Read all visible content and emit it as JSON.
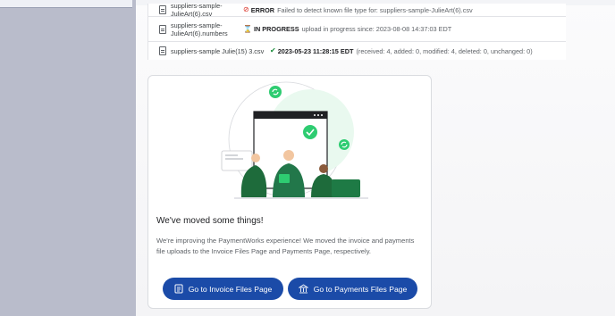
{
  "files": [
    {
      "name": "suppliers-sample-JulieArt(6).csv",
      "status_label": "ERROR",
      "status_detail": "Failed to detect known file type for: suppliers-sample-JulieArt(6).csv",
      "status_icon": "error-icon",
      "status_color": "#d93025"
    },
    {
      "name": "suppliers-sample-JulieArt(6).numbers",
      "status_label": "IN PROGRESS",
      "status_detail": "upload in progress since: 2023-08-08 14:37:03 EDT",
      "status_icon": "hourglass-icon",
      "status_color": "#f29900"
    },
    {
      "name": "suppliers-sample Julie(15) 3.csv",
      "status_label": "2023-05-23 11:28:15 EDT",
      "status_detail": "(received: 4, added: 0, modified: 4, deleted: 0, unchanged: 0)",
      "status_icon": "checkmark-icon",
      "status_color": "#1e8e3e"
    }
  ],
  "notice": {
    "title": "We've moved some things!",
    "body": "We're improving the PaymentWorks experience! We moved the invoice and payments file uploads to the Invoice Files Page and Payments Page, respectively.",
    "invoice_button": "Go to Invoice Files Page",
    "payments_button": "Go to Payments Files Page"
  },
  "colors": {
    "primary_button": "#1b4ba8",
    "accent_green": "#2ecc71",
    "sidebar": "#b9bccb"
  }
}
